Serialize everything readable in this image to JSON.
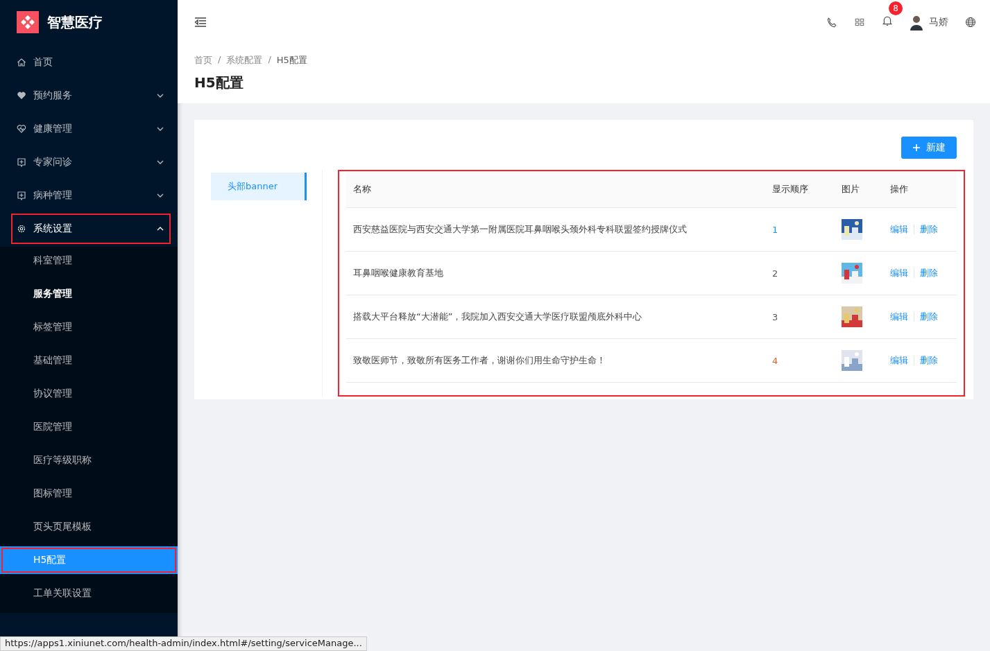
{
  "app": {
    "title": "智慧医疗"
  },
  "sidebar": {
    "items": [
      {
        "label": "首页",
        "expanded": false,
        "highlighted": false
      },
      {
        "label": "预约服务",
        "expanded": false,
        "highlighted": false
      },
      {
        "label": "健康管理",
        "expanded": false,
        "highlighted": false
      },
      {
        "label": "专家问诊",
        "expanded": false,
        "highlighted": false
      },
      {
        "label": "病种管理",
        "expanded": false,
        "highlighted": false
      },
      {
        "label": "系统设置",
        "expanded": true,
        "highlighted": true,
        "children": [
          {
            "label": "科室管理",
            "selected": false,
            "bold": false,
            "highlighted": false
          },
          {
            "label": "服务管理",
            "selected": false,
            "bold": true,
            "highlighted": false
          },
          {
            "label": "标签管理",
            "selected": false,
            "bold": false,
            "highlighted": false
          },
          {
            "label": "基础管理",
            "selected": false,
            "bold": false,
            "highlighted": false
          },
          {
            "label": "协议管理",
            "selected": false,
            "bold": false,
            "highlighted": false
          },
          {
            "label": "医院管理",
            "selected": false,
            "bold": false,
            "highlighted": false
          },
          {
            "label": "医疗等级职称",
            "selected": false,
            "bold": false,
            "highlighted": false
          },
          {
            "label": "图标管理",
            "selected": false,
            "bold": false,
            "highlighted": false
          },
          {
            "label": "页头页尾模板",
            "selected": false,
            "bold": false,
            "highlighted": false
          },
          {
            "label": "H5配置",
            "selected": true,
            "bold": false,
            "highlighted": true
          },
          {
            "label": "工单关联设置",
            "selected": false,
            "bold": false,
            "highlighted": false
          }
        ]
      }
    ]
  },
  "header": {
    "notification_count": "8",
    "user_name": "马娇"
  },
  "breadcrumb": [
    {
      "label": "首页"
    },
    {
      "separator": "/",
      "label": "系统配置"
    },
    {
      "separator": "/",
      "label": "H5配置"
    }
  ],
  "page_title": "H5配置",
  "new_button": "新建",
  "side_tabs": [
    {
      "label": "头部banner",
      "selected": true
    }
  ],
  "table": {
    "highlighted": true,
    "columns": [
      "名称",
      "显示顺序",
      "图片",
      "操作"
    ],
    "rows": [
      {
        "name": "西安慈益医院与西安交通大学第一附属医院耳鼻咽喉头颈外科专科联盟签约授牌仪式",
        "order": "1",
        "color": "#1890ff",
        "image": {
          "kind": "picture"
        },
        "actions": [
          "编辑",
          "删除"
        ]
      },
      {
        "name": "耳鼻咽喉健康教育基地",
        "order": "2",
        "color": "#595959",
        "image": {
          "kind": "picture"
        },
        "actions": [
          "编辑",
          "删除"
        ]
      },
      {
        "name": "搭载大平台释放“大潜能”，我院加入西安交通大学医疗联盟颅底外科中心",
        "order": "3",
        "color": "#595959",
        "image": {
          "kind": "picture"
        },
        "actions": [
          "编辑",
          "删除"
        ]
      },
      {
        "name": "致敬医师节，致敬所有医务工作者，谢谢你们用生命守护生命！",
        "order": "4",
        "color": "#e0622a",
        "image": {
          "kind": "picture"
        },
        "actions": [
          "编辑",
          "删除"
        ]
      }
    ]
  },
  "status_bar": "https://apps1.xiniunet.com/health-admin/index.html#/setting/serviceManage..."
}
